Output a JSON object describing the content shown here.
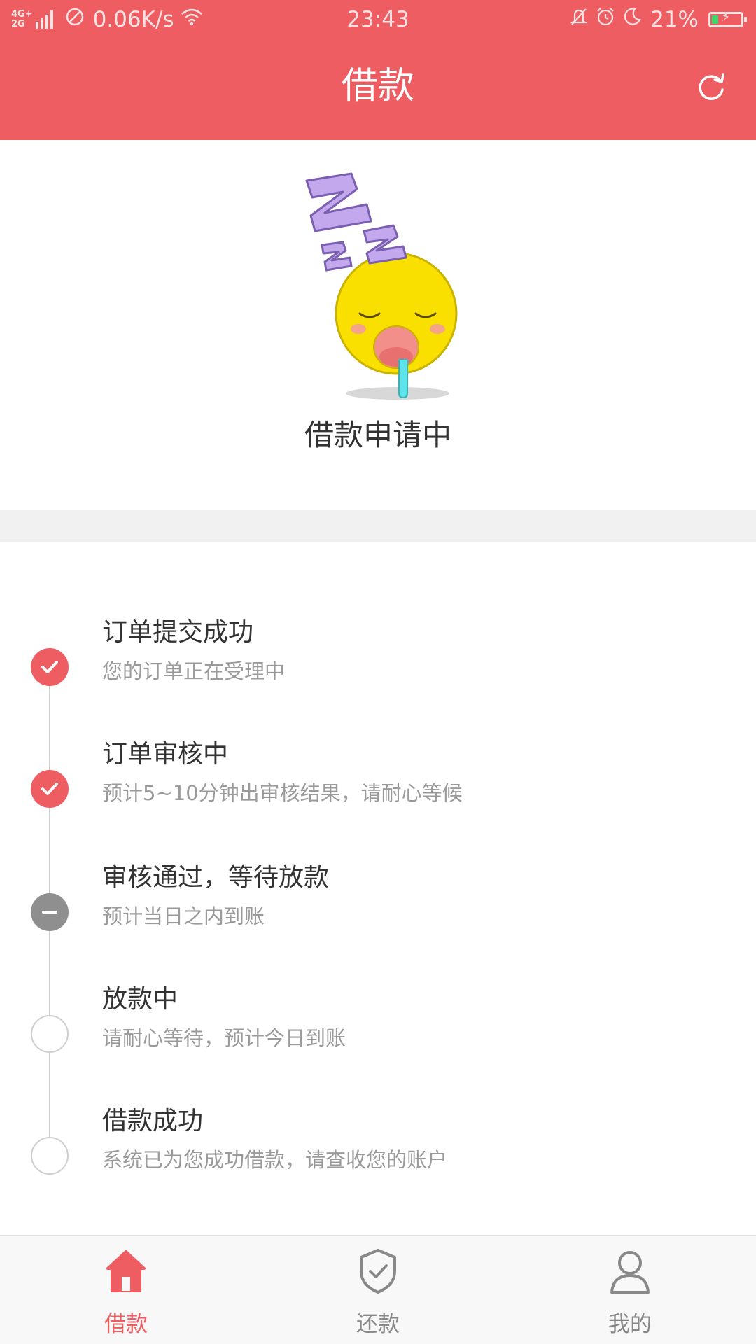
{
  "status_bar": {
    "network_top": "4G+",
    "network_bottom": "2G",
    "speed": "0.06K/s",
    "time": "23:43",
    "battery_percent": "21%",
    "battery_level": 0.21,
    "icons": [
      "signal-icon",
      "no-sim-icon",
      "wifi-icon",
      "mute-bell-icon",
      "alarm-icon",
      "moon-icon",
      "battery-charging-icon"
    ]
  },
  "header": {
    "title": "借款",
    "refresh_icon": "refresh-icon"
  },
  "hero": {
    "illustration": "sleeping-face-icon",
    "status_text": "借款申请中"
  },
  "steps": [
    {
      "title": "订单提交成功",
      "desc": "您的订单正在受理中",
      "state": "done"
    },
    {
      "title": "订单审核中",
      "desc": "预计5~10分钟出审核结果，请耐心等候",
      "state": "done"
    },
    {
      "title": "审核通过，等待放款",
      "desc": "预计当日之内到账",
      "state": "pending"
    },
    {
      "title": "放款中",
      "desc": "请耐心等待，预计今日到账",
      "state": "todo"
    },
    {
      "title": "借款成功",
      "desc": "系统已为您成功借款，请查收您的账户",
      "state": "todo"
    }
  ],
  "tabs": [
    {
      "label": "借款",
      "icon": "home-icon",
      "active": true
    },
    {
      "label": "还款",
      "icon": "shield-check-icon",
      "active": false
    },
    {
      "label": "我的",
      "icon": "user-icon",
      "active": false
    }
  ],
  "colors": {
    "accent": "#ee5d62",
    "pending": "#8f8f8f",
    "inactive": "#888888"
  }
}
